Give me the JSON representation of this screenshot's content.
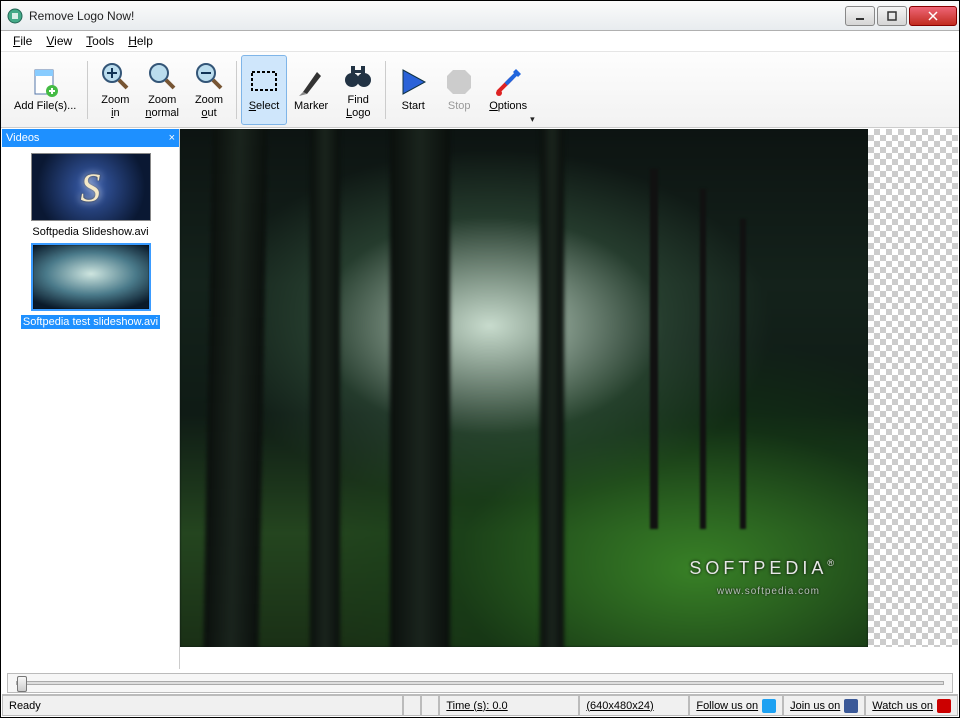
{
  "window": {
    "title": "Remove Logo Now!"
  },
  "menubar": {
    "file": "File",
    "view": "View",
    "tools": "Tools",
    "help": "Help"
  },
  "toolbar": {
    "add_files": "Add File(s)...",
    "zoom_in": "Zoom in",
    "zoom_normal": "Zoom normal",
    "zoom_out": "Zoom out",
    "select": "Select",
    "marker": "Marker",
    "find_logo": "Find Logo",
    "start": "Start",
    "stop": "Stop",
    "options": "Options"
  },
  "sidebar": {
    "title": "Videos",
    "items": [
      {
        "label": "Softpedia Slideshow.avi",
        "selected": false
      },
      {
        "label": "Softpedia test slideshow.avi",
        "selected": true
      }
    ]
  },
  "preview": {
    "watermark_text": "SOFTPEDIA",
    "watermark_url": "www.softpedia.com"
  },
  "statusbar": {
    "ready": "Ready",
    "time": "Time (s): 0.0",
    "dimensions": "(640x480x24)",
    "follow": "Follow us on",
    "join": "Join us on",
    "watch": "Watch us on"
  }
}
